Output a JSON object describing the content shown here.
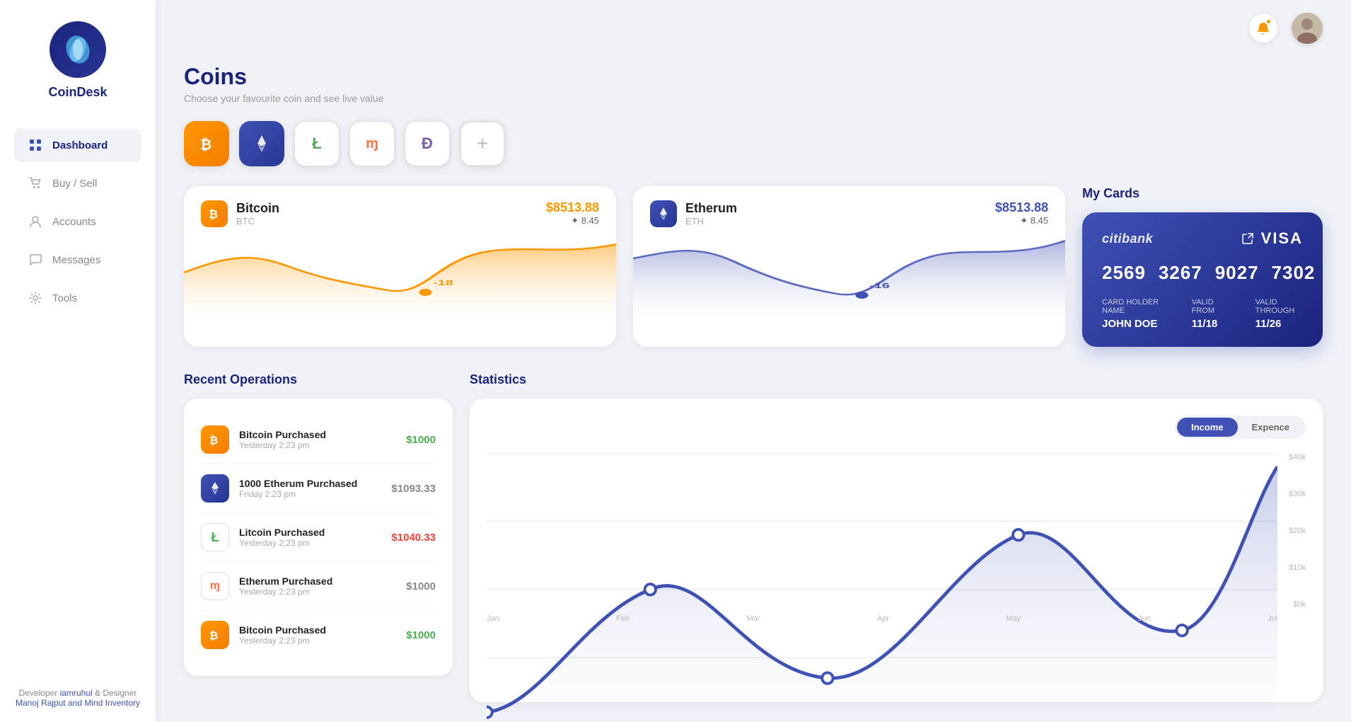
{
  "brand": {
    "name": "CoinDesk"
  },
  "nav": {
    "items": [
      {
        "id": "dashboard",
        "label": "Dashboard",
        "icon": "grid",
        "active": true
      },
      {
        "id": "buy-sell",
        "label": "Buy / Sell",
        "icon": "cart",
        "active": false
      },
      {
        "id": "accounts",
        "label": "Accounts",
        "icon": "person",
        "active": false
      },
      {
        "id": "messages",
        "label": "Messages",
        "icon": "message",
        "active": false
      },
      {
        "id": "tools",
        "label": "Tools",
        "icon": "gear",
        "active": false
      }
    ]
  },
  "sidebar_footer": {
    "text1": "Developer ",
    "developer": "iamruhul",
    "text2": " & Designer",
    "designer": "Manoj Rajput and Mind Inventory"
  },
  "page": {
    "title": "Coins",
    "subtitle": "Choose your favourite coin and see live value"
  },
  "coin_tabs": [
    {
      "id": "btc",
      "symbol": "₿",
      "class": "btc"
    },
    {
      "id": "eth",
      "symbol": "◆",
      "class": "eth"
    },
    {
      "id": "ltc",
      "symbol": "Ł",
      "class": "ltc"
    },
    {
      "id": "xmr",
      "symbol": "ɱ",
      "class": "xmr"
    },
    {
      "id": "dash",
      "symbol": "Đ",
      "class": "dash"
    },
    {
      "id": "add",
      "symbol": "+",
      "class": "add"
    }
  ],
  "coins": [
    {
      "id": "bitcoin",
      "name": "Bitcoin",
      "symbol": "BTC",
      "price": "$8513.88",
      "value": "✦ 8.45",
      "change": "-18",
      "type": "btc"
    },
    {
      "id": "ethereum",
      "name": "Etherum",
      "symbol": "ETH",
      "price": "$8513.88",
      "value": "✦ 8.45",
      "change": "-16",
      "type": "eth"
    }
  ],
  "my_cards": {
    "title": "My Cards",
    "bank": "citibank",
    "card_type": "VISA",
    "number": [
      "2569",
      "3267",
      "9027",
      "7302"
    ],
    "holder_label": "CARD HOLDER NAME",
    "holder": "JOHN DOE",
    "valid_from_label": "VALID FROM",
    "valid_from": "11/18",
    "valid_through_label": "VALID THROUGH",
    "valid_through": "11/26"
  },
  "recent_ops": {
    "title": "Recent Operations",
    "items": [
      {
        "name": "Bitcoin Purchased",
        "time": "Yesterday 2:23 pm",
        "amount": "$1000",
        "color": "green",
        "icon": "btc"
      },
      {
        "name": "1000 Etherum Purchased",
        "time": "Friday 2:23 pm",
        "amount": "$1093.33",
        "color": "gray",
        "icon": "eth"
      },
      {
        "name": "Litcoin Purchased",
        "time": "Yesterday 2:23 pm",
        "amount": "$1040.33",
        "color": "red",
        "icon": "ltc"
      },
      {
        "name": "Etherum Purchased",
        "time": "Yesterday 2:23 pm",
        "amount": "$1000",
        "color": "gray",
        "icon": "xmr"
      },
      {
        "name": "Bitcoin Purchased",
        "time": "Yesterday 2:23 pm",
        "amount": "$1000",
        "color": "green",
        "icon": "btc"
      }
    ]
  },
  "statistics": {
    "title": "Statistics",
    "toggle": {
      "income": "Income",
      "expense": "Expence"
    },
    "y_axis": [
      "$40k",
      "$30k",
      "$20k",
      "$10k",
      "$0k"
    ],
    "x_axis": [
      "Jan",
      "Feb",
      "Mar",
      "Apr",
      "May",
      "Jun",
      "Jul"
    ]
  }
}
